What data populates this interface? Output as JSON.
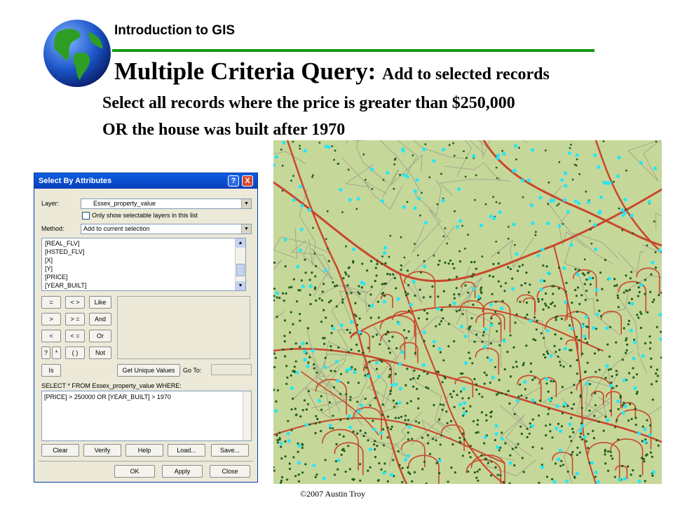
{
  "header": {
    "course": "Introduction to GIS",
    "title": "Multiple Criteria Query:",
    "title_sub": "Add to selected records",
    "line1": "Select all records where the price is greater than $250,000",
    "line2": "OR the house was built after 1970"
  },
  "dialog": {
    "title": "Select By Attributes",
    "help_btn": "?",
    "close_btn": "X",
    "layer_label": "Layer:",
    "layer_value": "Essex_property_value",
    "only_selectable": "Only show selectable layers in this list",
    "method_label": "Method:",
    "method_value": "Add to current selection",
    "fields": [
      "[REAL_FLV]",
      "[HSTED_FLV]",
      "[X]",
      "[Y]",
      "[PRICE]",
      "[YEAR_BUILT]"
    ],
    "operators": [
      "=",
      "< >",
      "Like",
      ">",
      "> =",
      "And",
      "<",
      "< =",
      "Or",
      "?",
      "*",
      "( )",
      "Not"
    ],
    "is_btn": "Is",
    "unique_btn": "Get Unique Values",
    "goto_label": "Go To:",
    "query_label": "SELECT * FROM Essex_property_value WHERE:",
    "expression": "[PRICE] > 250000 OR [YEAR_BUILT] > 1970",
    "actions": [
      "Clear",
      "Verify",
      "Help",
      "Load...",
      "Save..."
    ],
    "ok": "OK",
    "apply": "Apply",
    "close": "Close"
  },
  "map": {
    "colors": {
      "background": "#c6d79a",
      "road": "#c8472c",
      "selected": "#27e6f5",
      "parcel_dot": "#1f5e1f",
      "parcel_line": "#9a9d88"
    }
  },
  "footer": {
    "copyright": "©2007 Austin Troy"
  }
}
